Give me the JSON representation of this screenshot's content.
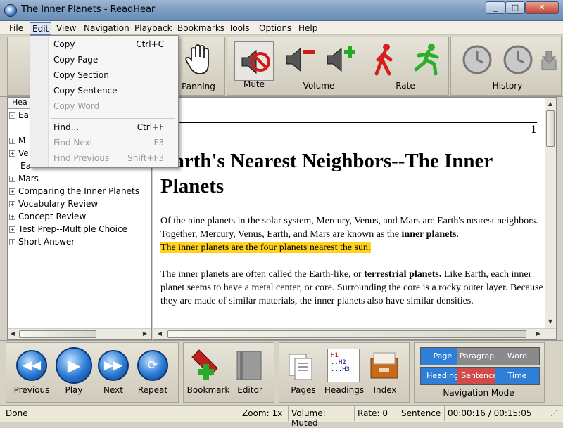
{
  "window": {
    "title": "The Inner Planets - ReadHear",
    "minimize": "_",
    "maximize": "□",
    "close": "✕"
  },
  "menu": [
    "File",
    "Edit",
    "View",
    "Navigation",
    "Playback",
    "Bookmarks",
    "Tools",
    "Options",
    "Help"
  ],
  "edit_menu": {
    "items": [
      {
        "label": "Copy",
        "shortcut": "Ctrl+C",
        "enabled": true
      },
      {
        "label": "Copy Page",
        "shortcut": "",
        "enabled": true
      },
      {
        "label": "Copy Section",
        "shortcut": "",
        "enabled": true
      },
      {
        "label": "Copy Sentence",
        "shortcut": "",
        "enabled": true
      },
      {
        "label": "Copy Word",
        "shortcut": "",
        "enabled": false
      },
      {
        "label": "Find...",
        "shortcut": "Ctrl+F",
        "enabled": true
      },
      {
        "label": "Find Next",
        "shortcut": "F3",
        "enabled": false
      },
      {
        "label": "Find Previous",
        "shortcut": "Shift+F3",
        "enabled": false
      }
    ]
  },
  "toolbar": {
    "panning": "Panning",
    "mute": "Mute",
    "volume": "Volume",
    "rate": "Rate",
    "history": "History"
  },
  "tree": {
    "header": "Hea",
    "items": [
      {
        "label": "Ea",
        "expander": "-"
      },
      {
        "label": "",
        "expander": ""
      },
      {
        "label": "M",
        "expander": "+"
      },
      {
        "label": "Ve",
        "expander": "+"
      },
      {
        "label": "Ea",
        "expander": ""
      },
      {
        "label": "Mars",
        "expander": "+"
      },
      {
        "label": "Comparing the Inner Planets",
        "expander": "+"
      },
      {
        "label": "Vocabulary Review",
        "expander": "+"
      },
      {
        "label": "Concept Review",
        "expander": "+"
      },
      {
        "label": "Test Prep--Multiple Choice",
        "expander": "+"
      },
      {
        "label": "Short Answer",
        "expander": "+"
      }
    ]
  },
  "document": {
    "page_number": "1",
    "heading": "Earth's Nearest Neighbors--The Inner Planets",
    "p1_a": "Of the nine planets in the solar system, Mercury, Venus, and Mars are Earth's nearest neighbors. Together, Mercury, Venus, Earth, and Mars are known as the ",
    "p1_bold": "inner planets",
    "p1_b": ".",
    "p1_highlight": "The inner planets are the four planets nearest the sun.",
    "p2_a": "The inner planets are often called the Earth-like, or ",
    "p2_bold": "terrestrial planets.",
    "p2_b": " Like Earth, each inner planet seems to have a metal center, or core. Surrounding the core is a rocky outer layer. Because they are made of similar materials, the inner planets also have similar densities."
  },
  "playback": {
    "previous": "Previous",
    "play": "Play",
    "next": "Next",
    "repeat": "Repeat"
  },
  "tools": {
    "bookmark": "Bookmark",
    "editor": "Editor",
    "pages": "Pages",
    "headings": "Headings",
    "index": "Index",
    "headings_icon_text": [
      "H1",
      "..H2",
      "...H3"
    ]
  },
  "nav_mode": {
    "title": "Navigation Mode",
    "buttons": [
      {
        "label": "Page",
        "color": "#2f7fd8"
      },
      {
        "label": "Paragraph",
        "color": "#8a8a8a"
      },
      {
        "label": "Word",
        "color": "#8a8a8a"
      },
      {
        "label": "Heading",
        "color": "#2f7fd8"
      },
      {
        "label": "Sentence",
        "color": "#d24b4b"
      },
      {
        "label": "Time",
        "color": "#2f7fd8"
      }
    ]
  },
  "status": {
    "state": "Done",
    "zoom": "Zoom: 1x",
    "volume": "Volume: Muted",
    "rate": "Rate: 0",
    "mode": "Sentence",
    "time": "00:00:16 / 00:15:05"
  }
}
